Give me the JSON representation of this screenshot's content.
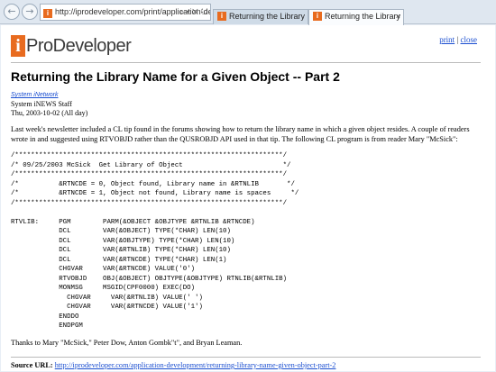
{
  "browser": {
    "url": "http://iprodeveloper.com/print/application-develo",
    "tabs": [
      {
        "label": "Returning the Library Nam...",
        "active": false
      },
      {
        "label": "Returning the Library Na...",
        "active": true
      }
    ],
    "back_glyph": "←",
    "forward_glyph": "→",
    "close_glyph": "×",
    "addr_icons": "⌕ ▾ ✕ ↻"
  },
  "site": {
    "logo_mark": "i",
    "logo_name": "ProDeveloper",
    "print_label": "print",
    "separator": "|",
    "close_label": "close",
    "accent_color": "#e86b1f"
  },
  "article": {
    "title": "Returning the Library Name for a Given Object -- Part 2",
    "network": "System iNetwork",
    "author": "System iNEWS Staff",
    "date": "Thu, 2003-10-02 (All day)",
    "intro": "Last week's newsletter included a CL tip found in the forums showing how to return the library name in which a given object resides. A couple of readers wrote in and suggested using RTVOBJD rather than the QUSROBJD API used in that tip. The following CL program is from reader Mary \"McSick\":",
    "code": "/*******************************************************************/\n/* 09/25/2003 McSick  Get Library of Object                         */\n/*******************************************************************/\n/*          &RTNCDE = 0, Object found, Library name in &RTNLIB       */\n/*          &RTNCDE = 1, Object not found, Library name is spaces     */\n/*******************************************************************/\n\nRTVLIB:     PGM        PARM(&OBJECT &OBJTYPE &RTNLIB &RTNCDE)\n            DCL        VAR(&OBJECT) TYPE(*CHAR) LEN(10)\n            DCL        VAR(&OBJTYPE) TYPE(*CHAR) LEN(10)\n            DCL        VAR(&RTNLIB) TYPE(*CHAR) LEN(10)\n            DCL        VAR(&RTNCDE) TYPE(*CHAR) LEN(1)\n            CHGVAR     VAR(&RTNCDE) VALUE('0')\n            RTVOBJD    OBJ(&OBJECT) OBJTYPE(&OBJTYPE) RTNLIB(&RTNLIB)\n            MONMSG     MSGID(CPF0000) EXEC(DO)\n              CHGVAR     VAR(&RTNLIB) VALUE(' ')\n              CHGVAR     VAR(&RTNCDE) VALUE('1')\n            ENDDO\n            ENDPGM",
    "thanks": "Thanks to Mary \"McSick,\" Peter Dow, Anton Gombk\"t\", and Bryan Leaman.",
    "source_label": "Source URL:",
    "source_url": "http://iprodeveloper.com/application-development/returning-library-name-given-object-part-2"
  }
}
